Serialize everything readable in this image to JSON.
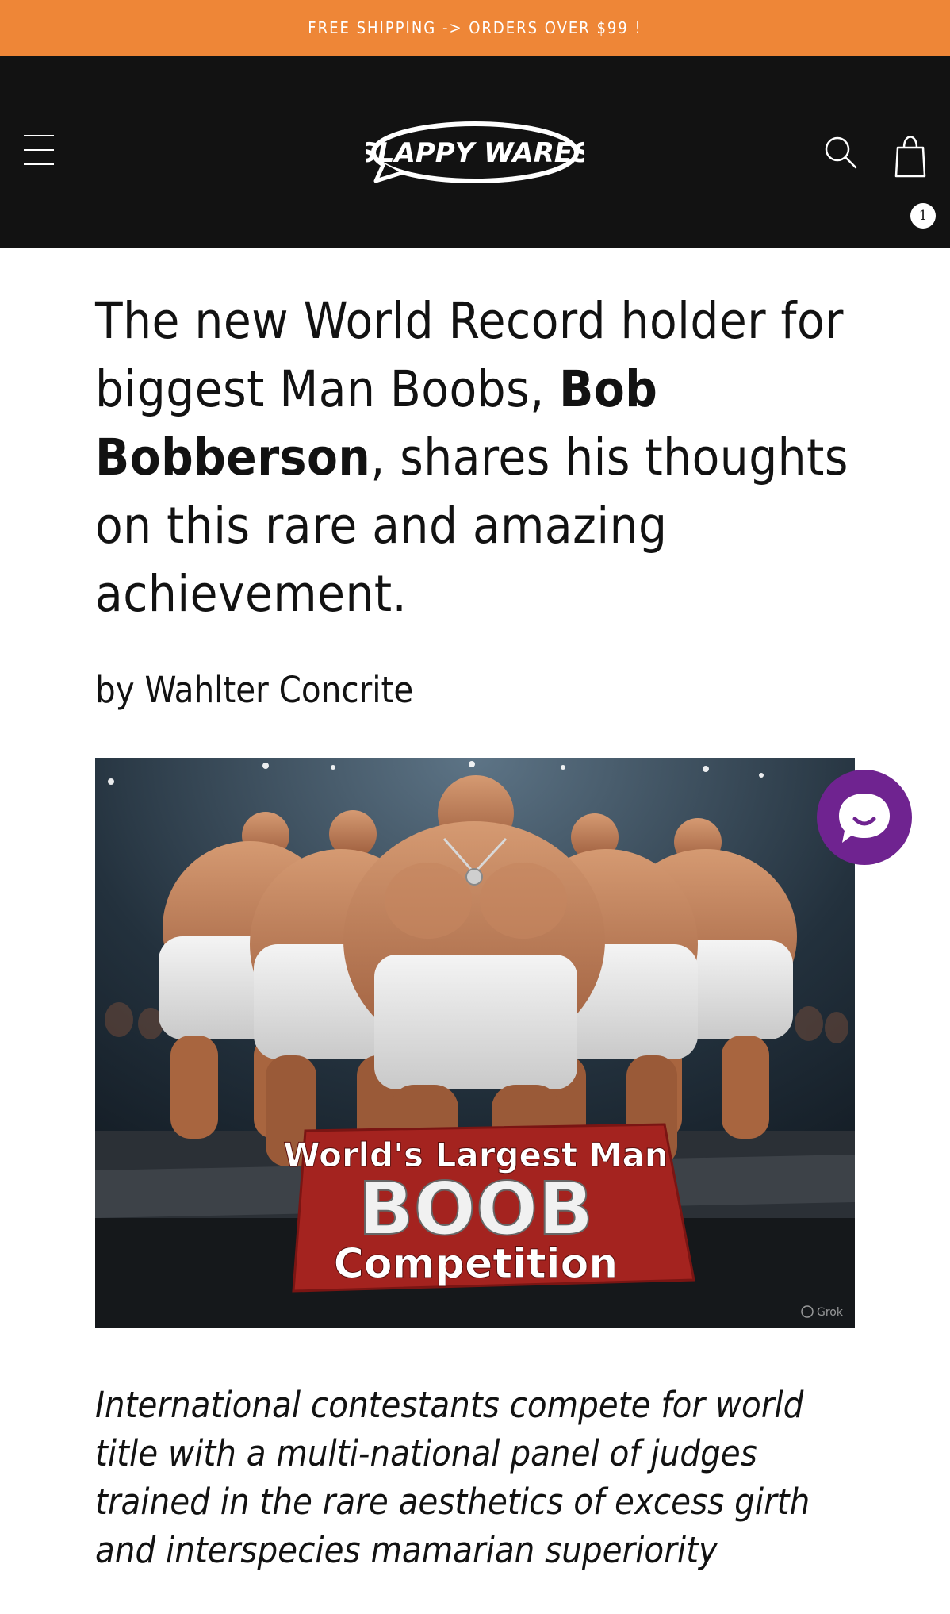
{
  "announcement": {
    "text": "FREE SHIPPING -> ORDERS OVER $99 !"
  },
  "header": {
    "logo_text": "SLAPPY WARES",
    "cart_count": "1"
  },
  "article": {
    "title_part1": "The new World Record holder for biggest Man Boobs, ",
    "title_bold": "Bob Bobberson",
    "title_part2": ", shares his thoughts on this rare and amazing achievement.",
    "byline": "by Wahlter Concrite",
    "image": {
      "sign_line1": "World's Largest Man",
      "sign_line2": "BOOB",
      "sign_line3": "Competition",
      "watermark": "Grok"
    },
    "caption": "International contestants compete for world title with a multi-national panel of judges trained in the rare aesthetics of excess girth and interspecies mamarian superiority"
  },
  "colors": {
    "announcement_bg": "#ee8637",
    "header_bg": "#121212",
    "chat_bg": "#6f2390",
    "sign_red": "#a4231f"
  },
  "icons": [
    "menu-icon",
    "logo",
    "search-icon",
    "cart-icon",
    "chat-icon"
  ]
}
